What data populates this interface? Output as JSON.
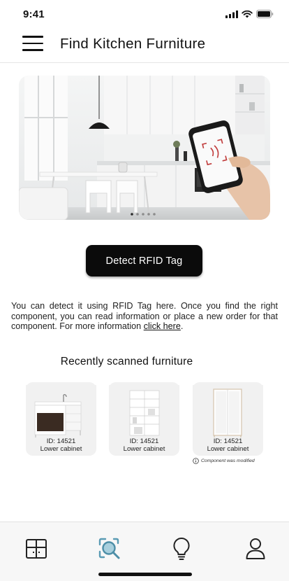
{
  "status_bar": {
    "time": "9:41",
    "icons": [
      "cellular-signal-icon",
      "wifi-icon",
      "battery-icon"
    ]
  },
  "header": {
    "menu_icon": "hamburger-menu-icon",
    "title": "Find Kitchen Furniture"
  },
  "hero": {
    "image": "kitchen-with-phone-rfid-scan-photo",
    "carousel": {
      "dots": 5,
      "active_index": 0
    }
  },
  "detect_button": {
    "label": "Detect RFID Tag"
  },
  "info": {
    "text": "You can detect it using RFID Tag here. Once you find the right component, you can read information or place a new order for that component. For more information ",
    "link_text": "click here",
    "trailing": "."
  },
  "recent": {
    "title": "Recently scanned furniture",
    "items": [
      {
        "id_label": "ID: 14521",
        "type": "Lower cabinet",
        "thumbnail": "lower-cabinet-with-oven-image"
      },
      {
        "id_label": "ID: 14521",
        "type": "Lower cabinet",
        "thumbnail": "open-shelving-unit-image"
      },
      {
        "id_label": "ID: 14521",
        "type": "Lower cabinet",
        "thumbnail": "tall-wardrobe-cabinet-image"
      }
    ],
    "modified_note": "Component was modified",
    "modified_icon": "info-icon"
  },
  "tab_bar": {
    "tabs": [
      {
        "name": "cabinet-icon",
        "active": false
      },
      {
        "name": "scan-search-icon",
        "active": true
      },
      {
        "name": "lightbulb-icon",
        "active": false
      },
      {
        "name": "profile-icon",
        "active": false
      }
    ],
    "accent": "#5a9bb4"
  }
}
